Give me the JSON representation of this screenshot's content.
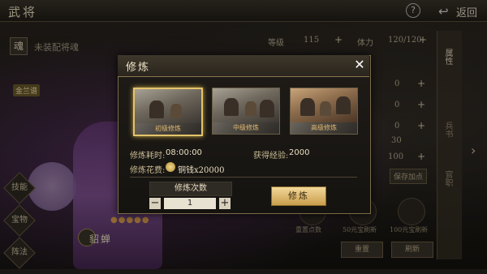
{
  "header": {
    "title": "武将",
    "help": "?",
    "back_label": "返回"
  },
  "left": {
    "soul_badge": "魂",
    "soul_text": "未装配将魂",
    "gold_tag": "金兰谱",
    "side_buttons": [
      "技能",
      "宝物",
      "阵法"
    ],
    "stars": "●●●●●",
    "hero_name": "貂蝉"
  },
  "stats": {
    "rows": [
      {
        "label": "等级",
        "value": "115",
        "label2": "体力",
        "value2": "120/120"
      },
      {
        "value": "0"
      },
      {
        "value": "0"
      },
      {
        "value": "0"
      },
      {
        "value": "30"
      },
      {
        "value": "100"
      }
    ],
    "save_plus": "保存加点",
    "side_tabs": [
      "属性",
      "兵书",
      "官职"
    ],
    "bottom_labels": [
      "重置点数",
      "50元宝刷新",
      "100元宝刷新"
    ],
    "bottom_buttons": [
      "重置",
      "刷新"
    ]
  },
  "modal": {
    "title": "修炼",
    "close": "✕",
    "modes": [
      {
        "label": "初级修炼",
        "selected": true
      },
      {
        "label": "中级修炼",
        "selected": false
      },
      {
        "label": "高级修炼",
        "selected": false
      }
    ],
    "time_label": "修炼耗时:",
    "time_value": "08:00:00",
    "exp_label": "获得经验:",
    "exp_value": "2000",
    "cost_label": "修炼花费:",
    "cost_value": "铜钱x20000",
    "count_label": "修炼次数",
    "count_value": "1",
    "train_button": "修炼"
  },
  "colors": {
    "accent": "#e3c46a",
    "button": "#e0c07a"
  }
}
